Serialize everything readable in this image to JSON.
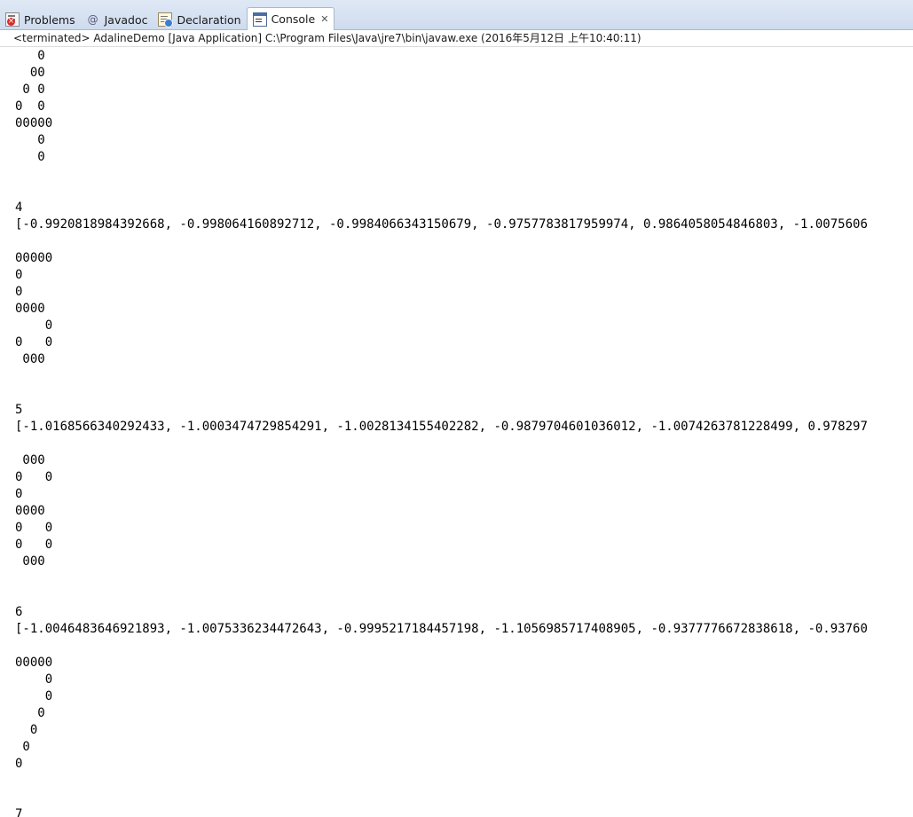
{
  "tabs": [
    {
      "label": "Problems",
      "icon": "problems-icon",
      "active": false
    },
    {
      "label": "Javadoc",
      "icon": "javadoc-icon",
      "active": false
    },
    {
      "label": "Declaration",
      "icon": "declaration-icon",
      "active": false
    },
    {
      "label": "Console",
      "icon": "console-icon",
      "active": true
    }
  ],
  "close_glyph": "✕",
  "javadoc_glyph": "@",
  "status": "<terminated> AdalineDemo [Java Application] C:\\Program Files\\Java\\jre7\\bin\\javaw.exe (2016年5月12日 上午10:40:11)",
  "console_lines": [
    "   0",
    "  00",
    " 0 0",
    "0  0",
    "00000",
    "   0",
    "   0",
    "",
    "",
    "4",
    "[-0.9920818984392668, -0.998064160892712, -0.9984066343150679, -0.9757783817959974, 0.9864058054846803, -1.0075606",
    "",
    "00000",
    "0",
    "0",
    "0000",
    "    0",
    "0   0",
    " 000",
    "",
    "",
    "5",
    "[-1.0168566340292433, -1.0003474729854291, -1.0028134155402282, -0.9879704601036012, -1.0074263781228499, 0.978297",
    "",
    " 000",
    "0   0",
    "0",
    "0000",
    "0   0",
    "0   0",
    " 000",
    "",
    "",
    "6",
    "[-1.0046483646921893, -1.0075336234472643, -0.9995217184457198, -1.1056985717408905, -0.9377776672838618, -0.93760",
    "",
    "00000",
    "    0",
    "    0",
    "   0",
    "  0",
    " 0",
    "0",
    "",
    "",
    "7"
  ]
}
